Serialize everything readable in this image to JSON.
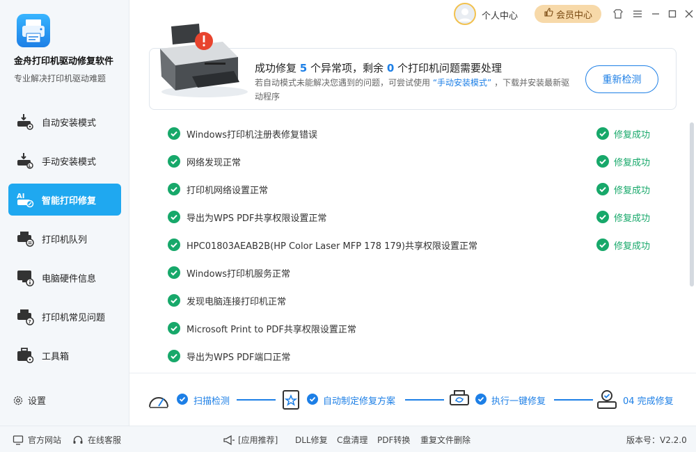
{
  "app": {
    "title": "金舟打印机驱动修复软件",
    "subtitle": "专业解决打印机驱动难题"
  },
  "sidebar": {
    "items": [
      {
        "label": "自动安装模式",
        "icon": "printer-download-gear-icon",
        "active": false
      },
      {
        "label": "手动安装模式",
        "icon": "printer-download-hand-icon",
        "active": false
      },
      {
        "label": "智能打印修复",
        "icon": "ai-printer-wrench-icon",
        "active": true
      },
      {
        "label": "打印机队列",
        "icon": "printer-queue-icon",
        "active": false
      },
      {
        "label": "电脑硬件信息",
        "icon": "monitor-info-icon",
        "active": false
      },
      {
        "label": "打印机常见问题",
        "icon": "printer-question-icon",
        "active": false
      },
      {
        "label": "工具箱",
        "icon": "toolbox-icon",
        "active": false
      }
    ],
    "settings_label": "设置"
  },
  "topbar": {
    "profile_label": "个人中心",
    "vip_label": "会员中心"
  },
  "banner": {
    "title_prefix": "成功修复",
    "fixed_count": "5",
    "title_middle": "个异常项，剩余",
    "remaining_count": "0",
    "title_suffix": "个打印机问题需要处理",
    "desc_prefix": "若自动模式未能解决您遇到的问题，可尝试使用",
    "desc_link": "“手动安装模式”",
    "desc_suffix": "，下载并安装最新驱动程序",
    "recheck_label": "重新检测"
  },
  "results": [
    {
      "text": "Windows打印机注册表修复错误",
      "status": "修复成功"
    },
    {
      "text": "网络发现正常",
      "status": "修复成功"
    },
    {
      "text": "打印机网络设置正常",
      "status": "修复成功"
    },
    {
      "text": "导出为WPS PDF共享权限设置正常",
      "status": "修复成功"
    },
    {
      "text": "HPC01803AEAB2B(HP Color Laser MFP 178 179)共享权限设置正常",
      "status": "修复成功"
    },
    {
      "text": "Windows打印机服务正常",
      "status": ""
    },
    {
      "text": "发现电脑连接打印机正常",
      "status": ""
    },
    {
      "text": "Microsoft Print to PDF共享权限设置正常",
      "status": ""
    },
    {
      "text": "导出为WPS PDF端口正常",
      "status": ""
    }
  ],
  "steps": [
    {
      "label": "扫描检测",
      "icon": "scan-gauge-icon"
    },
    {
      "label": "自动制定修复方案",
      "icon": "plan-document-star-icon"
    },
    {
      "label": "执行一键修复",
      "icon": "printer-refresh-icon"
    },
    {
      "label": "04 完成修复",
      "icon": "printer-done-icon"
    }
  ],
  "footer": {
    "website_label": "官方网站",
    "service_label": "在线客服",
    "recommend_label": "[应用推荐]",
    "links": [
      "DLL修复",
      "C盘清理",
      "PDF转换",
      "重复文件删除"
    ],
    "version": "版本号：V2.2.0"
  },
  "colors": {
    "accent": "#1d7fe6",
    "active_nav": "#1fa8f0",
    "success": "#17a86a",
    "vip": "#f7d9a9"
  }
}
